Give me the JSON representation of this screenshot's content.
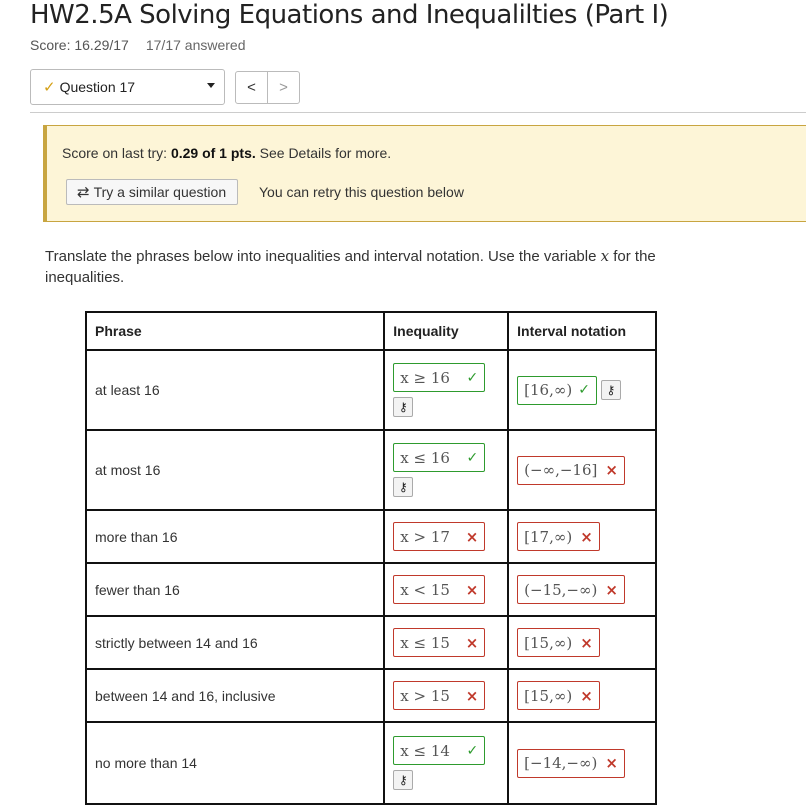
{
  "page": {
    "title": "HW2.5A Solving Equations and Inequalilties (Part I)",
    "score": "Score: 16.29/17",
    "answered": "17/17 answered"
  },
  "nav": {
    "question_label": "Question 17",
    "prev_label": "<",
    "next_label": ">"
  },
  "notice": {
    "last_try_prefix": "Score on last try: ",
    "last_try_score": "0.29 of 1 pts.",
    "last_try_suffix": " See Details for more.",
    "similar_button": "Try a similar question",
    "retry_text": "You can retry this question below"
  },
  "instructions": {
    "before": "Translate the phrases below into inequalities and interval notation. Use the variable ",
    "variable": "x",
    "after": " for the inequalities."
  },
  "table": {
    "headers": {
      "phrase": "Phrase",
      "inequality": "Inequality",
      "interval": "Interval notation"
    },
    "rows": [
      {
        "phrase": "at least 16",
        "inequality": "x ≥ 16",
        "interval": "[16,∞)"
      },
      {
        "phrase": "at most 16",
        "inequality": "x ≤ 16",
        "interval": "(−∞,−16]"
      },
      {
        "phrase": "more than 16",
        "inequality": "x > 17",
        "interval": "[17,∞)"
      },
      {
        "phrase": "fewer than 16",
        "inequality": "x < 15",
        "interval": "(−15,−∞)"
      },
      {
        "phrase": "strictly between 14 and 16",
        "inequality": "x ≤ 15",
        "interval": "[15,∞)"
      },
      {
        "phrase": "between 14 and 16, inclusive",
        "inequality": "x > 15",
        "interval": "[15,∞)"
      },
      {
        "phrase": "no more than 14",
        "inequality": "x ≤ 14",
        "interval": "[−14,−∞)"
      }
    ]
  },
  "marks": {
    "correct": "✓",
    "wrong": "×",
    "key_icon": "⚷"
  },
  "colors": {
    "correct": "#2e9b2e",
    "wrong": "#c0392b",
    "notice_bg": "#fdf5d7",
    "notice_border": "#c8a540"
  }
}
